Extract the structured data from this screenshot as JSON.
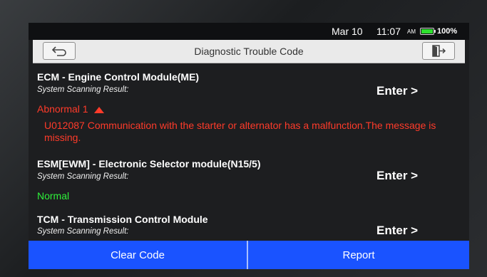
{
  "status_bar": {
    "date": "Mar 10",
    "time": "11:07",
    "ampm": "AM",
    "battery_percent": "100%",
    "battery_color": "#2ee02e"
  },
  "header": {
    "title": "Diagnostic Trouble Code",
    "back_icon": "back-arrow-icon",
    "exit_icon": "exit-door-icon"
  },
  "modules": [
    {
      "name": "ECM - Engine Control Module(ME)",
      "result_label": "System Scanning Result:",
      "enter_label": "Enter >",
      "status": "Abnormal 1",
      "status_color": "#ff3b2a",
      "dtc": "U012087 Communication with the starter or alternator has a malfunction.The message is missing."
    },
    {
      "name": "ESM[EWM] - Electronic Selector module(N15/5)",
      "result_label": "System Scanning Result:",
      "enter_label": "Enter >",
      "status": "Normal",
      "status_color": "#2ef03a"
    },
    {
      "name": "TCM - Transmission Control Module",
      "result_label": "System Scanning Result:",
      "enter_label": "Enter >"
    }
  ],
  "footer": {
    "clear_code_label": "Clear Code",
    "report_label": "Report",
    "accent_color": "#1a53ff"
  }
}
